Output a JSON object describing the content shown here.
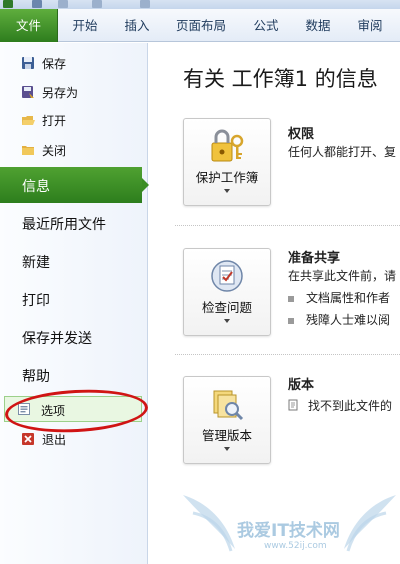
{
  "ribbon": {
    "tabs": [
      {
        "label": "文件"
      },
      {
        "label": "开始"
      },
      {
        "label": "插入"
      },
      {
        "label": "页面布局"
      },
      {
        "label": "公式"
      },
      {
        "label": "数据"
      },
      {
        "label": "审阅"
      }
    ],
    "accent_color": "#3a8d24"
  },
  "backstage": {
    "commands_top": [
      {
        "label": "保存",
        "icon": "save-icon"
      },
      {
        "label": "另存为",
        "icon": "save-as-icon"
      },
      {
        "label": "打开",
        "icon": "open-folder-icon"
      },
      {
        "label": "关闭",
        "icon": "close-folder-icon"
      }
    ],
    "nav": [
      {
        "label": "信息",
        "selected": true
      },
      {
        "label": "最近所用文件"
      },
      {
        "label": "新建"
      },
      {
        "label": "打印"
      },
      {
        "label": "保存并发送"
      },
      {
        "label": "帮助"
      }
    ],
    "commands_bottom": [
      {
        "label": "选项",
        "icon": "options-icon"
      },
      {
        "label": "退出",
        "icon": "exit-icon"
      }
    ]
  },
  "info": {
    "title": "有关 工作簿1 的信息",
    "sections": [
      {
        "button_label": "保护工作簿",
        "icon": "lock-keys-icon",
        "heading": "权限",
        "description": "任何人都能打开、复"
      },
      {
        "button_label": "检查问题",
        "icon": "inspect-document-icon",
        "heading": "准备共享",
        "description": "在共享此文件前，请",
        "bullets": [
          "文档属性和作者",
          "残障人士难以阅"
        ]
      },
      {
        "button_label": "管理版本",
        "icon": "manage-versions-icon",
        "heading": "版本",
        "description": "找不到此文件的"
      }
    ]
  },
  "watermark": {
    "text": "我爱IT技术网",
    "url": "www.52ij.com"
  }
}
